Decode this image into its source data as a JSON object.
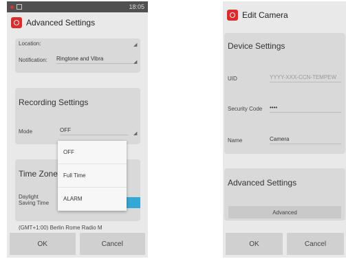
{
  "left": {
    "status_time": "18:05",
    "title": "Advanced Settings",
    "location_label": "Location:",
    "notification_label": "Notification:",
    "notification_value": "Ringtone and Vibra",
    "recording_title": "Recording Settings",
    "mode_label": "Mode",
    "mode_value": "OFF",
    "mode_options": [
      "OFF",
      "Full Time",
      "ALARM"
    ],
    "timezone_title": "Time Zone",
    "daylight_label": "Daylight Saving Time",
    "timezone_footer": "(GMT+1:00) Berlin Rome Radio M",
    "ok_label": "OK",
    "cancel_label": "Cancel"
  },
  "right": {
    "title": "Edit Camera",
    "device_title": "Device Settings",
    "uid_label": "UID",
    "uid_value": "YYYY-XXX-CCN-TEMPEW",
    "security_label": "Security Code",
    "security_value": "••••",
    "name_label": "Name",
    "name_value": "Camera",
    "advanced_title": "Advanced Settings",
    "advanced_button": "Advanced",
    "ok_label": "OK",
    "cancel_label": "Cancel"
  },
  "colors": {
    "accent": "#31a8d6",
    "icon": "#e02a2a",
    "status_bar": "#505050"
  }
}
